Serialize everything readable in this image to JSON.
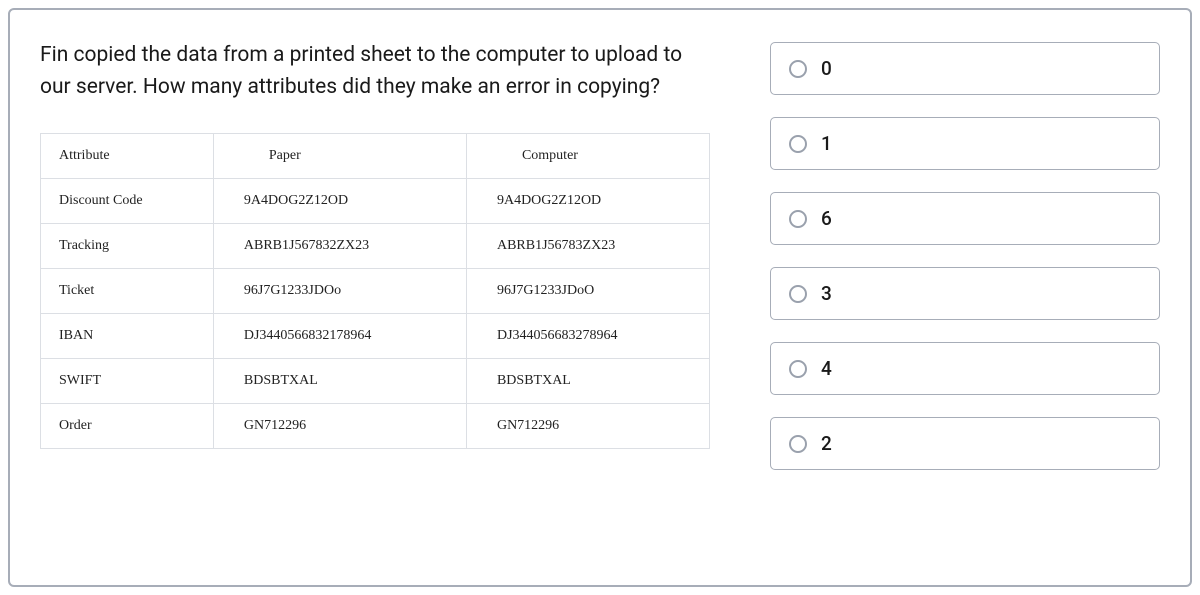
{
  "question": "Fin copied the data from a printed sheet to the computer to upload to our server. How many attributes did they make an error in copying?",
  "table": {
    "headers": [
      "Attribute",
      "Paper",
      "Computer"
    ],
    "rows": [
      {
        "attr": "Discount Code",
        "paper": "9A4DOG2Z12OD",
        "computer": "9A4DOG2Z12OD"
      },
      {
        "attr": "Tracking",
        "paper": "ABRB1J567832ZX23",
        "computer": "ABRB1J56783ZX23"
      },
      {
        "attr": "Ticket",
        "paper": "96J7G1233JDOo",
        "computer": "96J7G1233JDoO"
      },
      {
        "attr": "IBAN",
        "paper": "DJ3440566832178964",
        "computer": "DJ344056683278964"
      },
      {
        "attr": "SWIFT",
        "paper": "BDSBTXAL",
        "computer": "BDSBTXAL"
      },
      {
        "attr": "Order",
        "paper": "GN712296",
        "computer": "GN712296"
      }
    ]
  },
  "options": [
    {
      "label": "0"
    },
    {
      "label": "1"
    },
    {
      "label": "6"
    },
    {
      "label": "3"
    },
    {
      "label": "4"
    },
    {
      "label": "2"
    }
  ]
}
